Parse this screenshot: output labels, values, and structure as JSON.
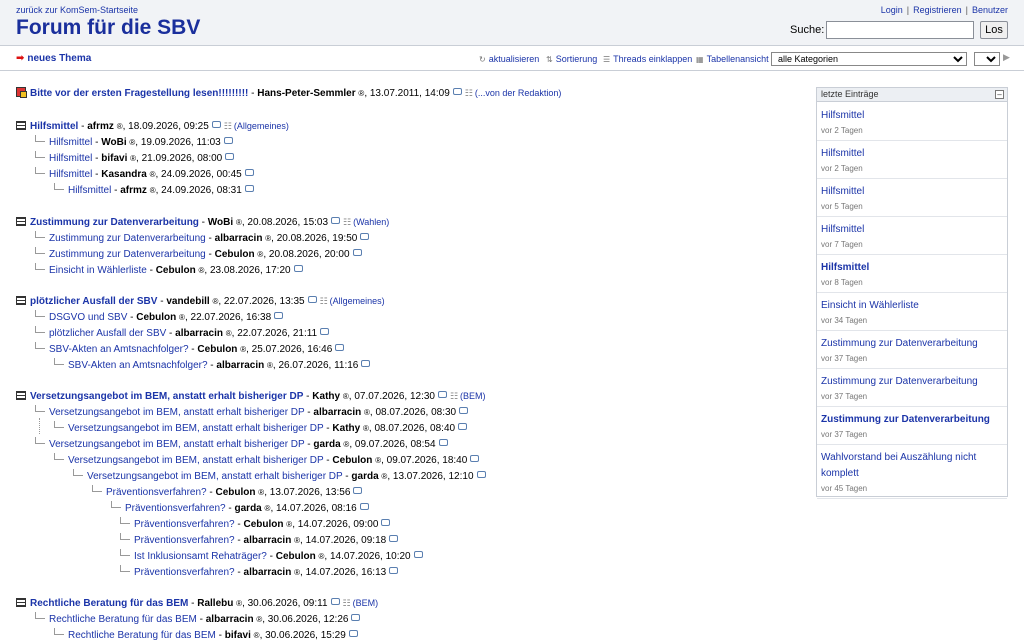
{
  "header": {
    "back_link": "zurück zur KomSem-Startseite",
    "title": "Forum für die SBV",
    "login": "Login",
    "register": "Registrieren",
    "user": "Benutzer",
    "search_label": "Suche:",
    "search_value": "",
    "search_button": "Los"
  },
  "toolbar": {
    "new_thread": "neues Thema",
    "refresh": "aktualisieren",
    "sort": "Sortierung",
    "collapse": "Threads einklappen",
    "table_view": "Tabellenansicht",
    "category_selected": "alle Kategorien",
    "page_selected": "1"
  },
  "threads": {
    "r0": {
      "title": "Bitte vor der ersten Fragestellung lesen!!!!!!!!!",
      "author": "Hans-Peter-Semmler",
      "date": ", 13.07.2011, 14:09",
      "cat": "(...von der Redaktion)"
    },
    "r1": {
      "title": "Hilfsmittel",
      "author": "afrmz",
      "date": ", 18.09.2026, 09:25",
      "cat": "(Allgemeines)"
    },
    "r2": {
      "title": "Hilfsmittel",
      "author": "WoBi",
      "date": ", 19.09.2026, 11:03"
    },
    "r3": {
      "title": "Hilfsmittel",
      "author": "bifavi",
      "date": ", 21.09.2026, 08:00"
    },
    "r4": {
      "title": "Hilfsmittel",
      "author": "Kasandra",
      "date": ", 24.09.2026, 00:45"
    },
    "r5": {
      "title": "Hilfsmittel",
      "author": "afrmz",
      "date": ", 24.09.2026, 08:31"
    },
    "r6": {
      "title": "Zustimmung zur Datenverarbeitung",
      "author": "WoBi",
      "date": ", 20.08.2026, 15:03",
      "cat": "(Wahlen)"
    },
    "r7": {
      "title": "Zustimmung zur Datenverarbeitung",
      "author": "albarracin",
      "date": ", 20.08.2026, 19:50"
    },
    "r8": {
      "title": "Zustimmung zur Datenverarbeitung",
      "author": "Cebulon",
      "date": ", 20.08.2026, 20:00"
    },
    "r9": {
      "title": "Einsicht in Wählerliste",
      "author": "Cebulon",
      "date": ", 23.08.2026, 17:20"
    },
    "r10": {
      "title": "plötzlicher Ausfall der SBV",
      "author": "vandebill",
      "date": ", 22.07.2026, 13:35",
      "cat": "(Allgemeines)"
    },
    "r11": {
      "title": "DSGVO und SBV",
      "author": "Cebulon",
      "date": ", 22.07.2026, 16:38"
    },
    "r12": {
      "title": "plötzlicher Ausfall der SBV",
      "author": "albarracin",
      "date": ", 22.07.2026, 21:11"
    },
    "r13": {
      "title": "SBV-Akten an Amtsnachfolger?",
      "author": "Cebulon",
      "date": ", 25.07.2026, 16:46"
    },
    "r14": {
      "title": "SBV-Akten an Amtsnachfolger?",
      "author": "albarracin",
      "date": ", 26.07.2026, 11:16"
    },
    "r15": {
      "title": "Versetzungsangebot im BEM, anstatt erhalt bisheriger DP",
      "author": "Kathy",
      "date": ", 07.07.2026, 12:30",
      "cat": "(BEM)"
    },
    "r16": {
      "title": "Versetzungsangebot im BEM, anstatt erhalt bisheriger DP",
      "author": "albarracin",
      "date": ", 08.07.2026, 08:30"
    },
    "r17": {
      "title": "Versetzungsangebot im BEM, anstatt erhalt bisheriger DP",
      "author": "Kathy",
      "date": ", 08.07.2026, 08:40"
    },
    "r18": {
      "title": "Versetzungsangebot im BEM, anstatt erhalt bisheriger DP",
      "author": "garda",
      "date": ", 09.07.2026, 08:54"
    },
    "r19": {
      "title": "Versetzungsangebot im BEM, anstatt erhalt bisheriger DP",
      "author": "Cebulon",
      "date": ", 09.07.2026, 18:40"
    },
    "r20": {
      "title": "Versetzungsangebot im BEM, anstatt erhalt bisheriger DP",
      "author": "garda",
      "date": ", 13.07.2026, 12:10"
    },
    "r21": {
      "title": "Präventionsverfahren?",
      "author": "Cebulon",
      "date": ", 13.07.2026, 13:56"
    },
    "r22": {
      "title": "Präventionsverfahren?",
      "author": "garda",
      "date": ", 14.07.2026, 08:16"
    },
    "r23": {
      "title": "Präventionsverfahren?",
      "author": "Cebulon",
      "date": ", 14.07.2026, 09:00"
    },
    "r24": {
      "title": "Präventionsverfahren?",
      "author": "albarracin",
      "date": ", 14.07.2026, 09:18"
    },
    "r25": {
      "title": "Ist Inklusionsamt Rehaträger?",
      "author": "Cebulon",
      "date": ", 14.07.2026, 10:20"
    },
    "r26": {
      "title": "Präventionsverfahren?",
      "author": "albarracin",
      "date": ", 14.07.2026, 16:13"
    },
    "r27": {
      "title": "Rechtliche Beratung für das BEM",
      "author": "Rallebu",
      "date": ", 30.06.2026, 09:11",
      "cat": "(BEM)"
    },
    "r28": {
      "title": "Rechtliche Beratung für das BEM",
      "author": "albarracin",
      "date": ", 30.06.2026, 12:26"
    },
    "r29": {
      "title": "Rechtliche Beratung für das BEM",
      "author": "bifavi",
      "date": ", 30.06.2026, 15:29"
    }
  },
  "reg_mark": "®",
  "sidebar": {
    "title": "letzte Einträge",
    "e0": {
      "title": "Hilfsmittel",
      "age": "vor 2 Tagen"
    },
    "e1": {
      "title": "Hilfsmittel",
      "age": "vor 2 Tagen"
    },
    "e2": {
      "title": "Hilfsmittel",
      "age": "vor 5 Tagen"
    },
    "e3": {
      "title": "Hilfsmittel",
      "age": "vor 7 Tagen"
    },
    "e4": {
      "title": "Hilfsmittel",
      "age": "vor 8 Tagen"
    },
    "e5": {
      "title": "Einsicht in Wählerliste",
      "age": "vor 34 Tagen"
    },
    "e6": {
      "title": "Zustimmung zur Datenverarbeitung",
      "age": "vor 37 Tagen"
    },
    "e7": {
      "title": "Zustimmung zur Datenverarbeitung",
      "age": "vor 37 Tagen"
    },
    "e8": {
      "title": "Zustimmung zur Datenverarbeitung",
      "age": "vor 37 Tagen"
    },
    "e9": {
      "title": "Wahlvorstand bei Auszählung nicht komplett",
      "age": "vor 45 Tagen"
    }
  },
  "colors": {
    "link": "#1b34a8",
    "title": "#1a2f9c",
    "header_bg": "#f1f3f6"
  }
}
